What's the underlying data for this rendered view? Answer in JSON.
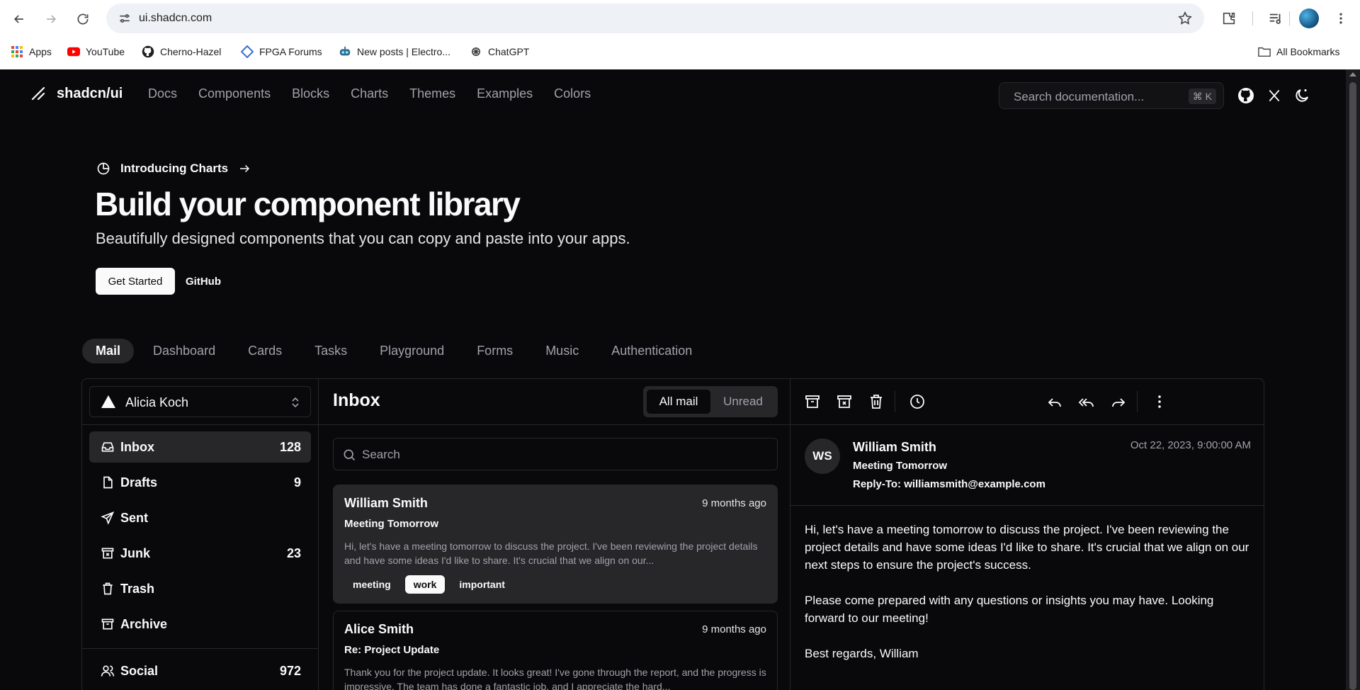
{
  "browser": {
    "url": "ui.shadcn.com",
    "bookmarks": [
      {
        "label": "Apps",
        "icon": "apps-grid-icon"
      },
      {
        "label": "YouTube",
        "icon": "youtube-icon"
      },
      {
        "label": "Cherno-Hazel",
        "icon": "github-icon"
      },
      {
        "label": "FPGA Forums",
        "icon": "diamond-icon"
      },
      {
        "label": "New posts | Electro...",
        "icon": "robot-icon"
      },
      {
        "label": "ChatGPT",
        "icon": "chatgpt-icon"
      }
    ],
    "all_bookmarks": "All Bookmarks"
  },
  "site": {
    "logo": "shadcn/ui",
    "nav": [
      "Docs",
      "Components",
      "Blocks",
      "Charts",
      "Themes",
      "Examples",
      "Colors"
    ],
    "search_placeholder": "Search documentation...",
    "search_shortcut": "⌘ K"
  },
  "hero": {
    "intro": "Introducing Charts",
    "title": "Build your component library",
    "subtitle": "Beautifully designed components that you can copy and paste into your apps.",
    "primary_button": "Get Started",
    "secondary_button": "GitHub"
  },
  "example_tabs": [
    "Mail",
    "Dashboard",
    "Cards",
    "Tasks",
    "Playground",
    "Forms",
    "Music",
    "Authentication"
  ],
  "mail": {
    "account": "Alicia Koch",
    "folders": [
      {
        "label": "Inbox",
        "count": "128",
        "icon": "inbox-icon"
      },
      {
        "label": "Drafts",
        "count": "9",
        "icon": "file-icon"
      },
      {
        "label": "Sent",
        "count": "",
        "icon": "send-icon"
      },
      {
        "label": "Junk",
        "count": "23",
        "icon": "archive-x-icon"
      },
      {
        "label": "Trash",
        "count": "",
        "icon": "trash-icon"
      },
      {
        "label": "Archive",
        "count": "",
        "icon": "archive-icon"
      }
    ],
    "categories": [
      {
        "label": "Social",
        "count": "972",
        "icon": "users-icon"
      }
    ],
    "list_title": "Inbox",
    "filter_all": "All mail",
    "filter_unread": "Unread",
    "search_placeholder": "Search",
    "messages": [
      {
        "from": "William Smith",
        "time": "9 months ago",
        "subject": "Meeting Tomorrow",
        "preview": "Hi, let's have a meeting tomorrow to discuss the project. I've been reviewing the project details and have some ideas I'd like to share. It's crucial that we align on our...",
        "tags": [
          "meeting",
          "work",
          "important"
        ]
      },
      {
        "from": "Alice Smith",
        "time": "9 months ago",
        "subject": "Re: Project Update",
        "preview": "Thank you for the project update. It looks great! I've gone through the report, and the progress is impressive. The team has done a fantastic job, and I appreciate the hard...",
        "tags": []
      }
    ],
    "reader": {
      "initials": "WS",
      "from": "William Smith",
      "subject": "Meeting Tomorrow",
      "reply_to": "Reply-To: williamsmith@example.com",
      "date": "Oct 22, 2023, 9:00:00 AM",
      "body": [
        "Hi, let's have a meeting tomorrow to discuss the project. I've been reviewing the project details and have some ideas I'd like to share. It's crucial that we align on our next steps to ensure the project's success.",
        "Please come prepared with any questions or insights you may have. Looking forward to our meeting!",
        "Best regards, William"
      ]
    }
  }
}
